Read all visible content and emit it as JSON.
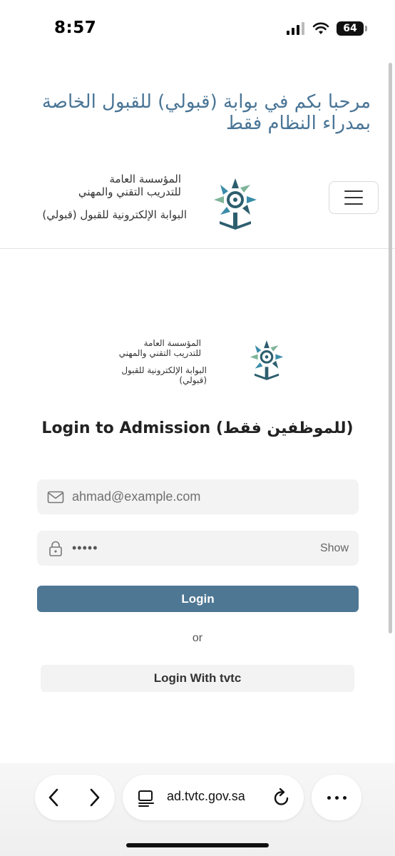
{
  "status_bar": {
    "time": "8:57",
    "battery": "64",
    "icons": [
      "cellular-signal-icon",
      "wifi-icon",
      "battery-icon"
    ]
  },
  "banner": {
    "line1": "مرحبا بكم في بوابة (قبولي) للقبول الخاصة",
    "line2": "بمدراء النظام فقط"
  },
  "header": {
    "brand_line1": "المؤسسة العامة",
    "brand_line2": "للتدريب التقني والمهني",
    "brand_line3": "البوابة الإلكترونية للقبول (قبولي)",
    "menu_icon": "hamburger-menu-icon"
  },
  "login": {
    "logo_line1": "المؤسسة العامة",
    "logo_line2": "للتدريب التقني والمهني",
    "logo_line3": "البوابة الإلكترونية للقبول (قبولي)",
    "title": "Login to Admission (للموظفين فقط)",
    "email_value": "ahmad@example.com",
    "password_value": "•••••",
    "show_label": "Show",
    "login_button": "Login",
    "or_text": "or",
    "tvtc_button": "Login With tvtc"
  },
  "browser": {
    "url": "ad.tvtc.gov.sa",
    "icons": [
      "back-icon",
      "forward-icon",
      "reader-icon",
      "reload-icon",
      "more-icon"
    ]
  },
  "colors": {
    "accent": "#4e7794",
    "banner_text": "#4a7596",
    "field_bg": "#f3f3f4"
  }
}
